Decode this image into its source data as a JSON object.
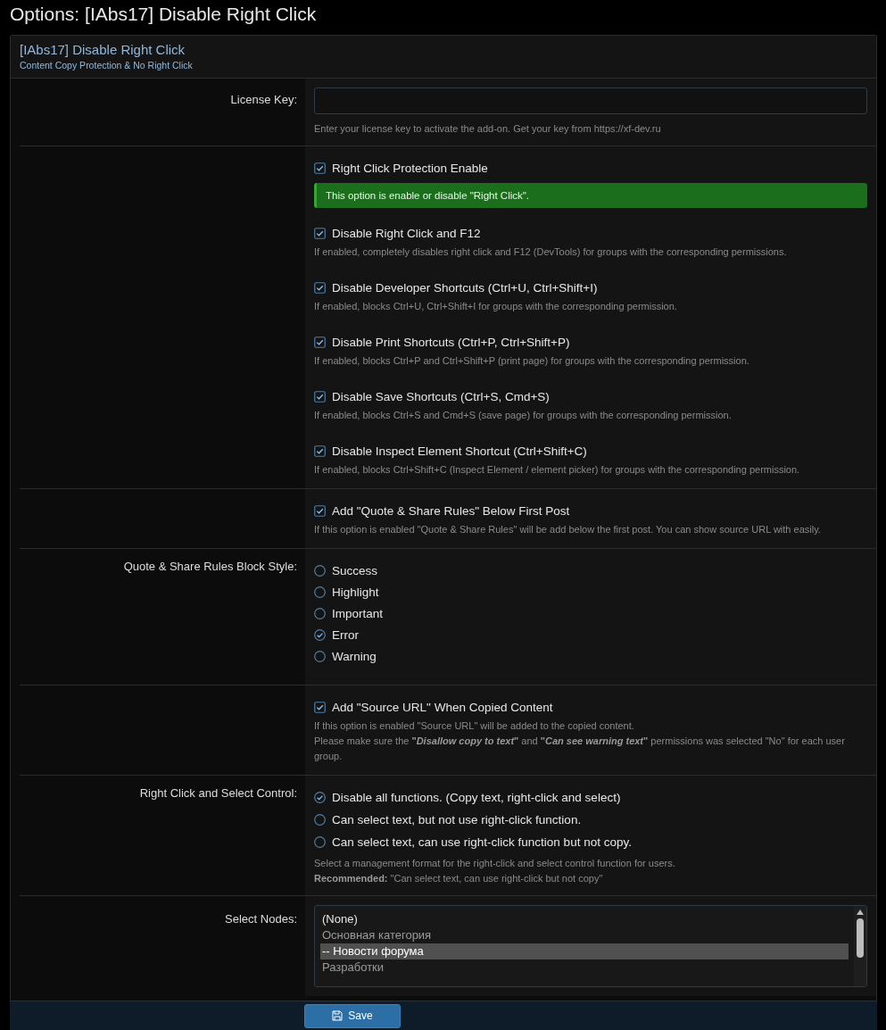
{
  "page_title": "Options: [IAbs17] Disable Right Click",
  "card": {
    "title": "[IAbs17] Disable Right Click",
    "subtitle": "Content Copy Protection & No Right Click"
  },
  "rows": [
    {
      "kind": "input",
      "label": "License Key:",
      "hint": [
        "Enter your license key to activate the add-on. Get your key from https://xf-dev.ru"
      ]
    },
    {
      "kind": "checks",
      "items": [
        {
          "label": "Right Click Protection Enable",
          "checked": true,
          "notice": "This option is enable or disable \"Right Click\"."
        },
        {
          "label": "Disable Right Click and F12",
          "checked": true,
          "hint": [
            "If enabled, completely disables right click and F12 (DevTools) for groups with the corresponding permissions."
          ]
        },
        {
          "label": "Disable Developer Shortcuts (Ctrl+U, Ctrl+Shift+I)",
          "checked": true,
          "hint": [
            "If enabled, blocks Ctrl+U, Ctrl+Shift+I for groups with the corresponding permission."
          ]
        },
        {
          "label": "Disable Print Shortcuts (Ctrl+P, Ctrl+Shift+P)",
          "checked": true,
          "hint": [
            "If enabled, blocks Ctrl+P and Ctrl+Shift+P (print page) for groups with the corresponding permission."
          ]
        },
        {
          "label": "Disable Save Shortcuts (Ctrl+S, Cmd+S)",
          "checked": true,
          "hint": [
            "If enabled, blocks Ctrl+S and Cmd+S (save page) for groups with the corresponding permission."
          ]
        },
        {
          "label": "Disable Inspect Element Shortcut (Ctrl+Shift+C)",
          "checked": true,
          "hint": [
            "If enabled, blocks Ctrl+Shift+C (Inspect Element / element picker) for groups with the corresponding permission."
          ]
        }
      ]
    },
    {
      "kind": "checks",
      "items": [
        {
          "label": "Add \"Quote & Share Rules\" Below First Post",
          "checked": true,
          "hint": [
            "If this option is enabled \"Quote & Share Rules\" will be add below the first post. You can show source URL with easily."
          ]
        }
      ]
    },
    {
      "kind": "radios",
      "label": "Quote & Share Rules Block Style:",
      "options": [
        {
          "label": "Success",
          "selected": false
        },
        {
          "label": "Highlight",
          "selected": false
        },
        {
          "label": "Important",
          "selected": false
        },
        {
          "label": "Error",
          "selected": true
        },
        {
          "label": "Warning",
          "selected": false
        }
      ]
    },
    {
      "kind": "checks",
      "items": [
        {
          "label": "Add \"Source URL\" When Copied Content",
          "checked": true,
          "hint": [
            "If this option is enabled \"Source URL\" will be added to the copied content.",
            "Please make sure the **\"*Disallow copy to text*\"** and **\"*Can see warning text*\"** permissions was selected \"No\" for each user group."
          ]
        }
      ]
    },
    {
      "kind": "radios",
      "label": "Right Click and Select Control:",
      "options": [
        {
          "label": "Disable all functions. (Copy text, right-click and select)",
          "selected": true
        },
        {
          "label": "Can select text, but not use right-click function.",
          "selected": false
        },
        {
          "label": "Can select text, can use right-click function but not copy.",
          "selected": false
        }
      ],
      "hint": [
        "Select a management format for the right-click and select control function for users.",
        "**Recommended:** \"Can select text, can use right-click but not copy\""
      ]
    },
    {
      "kind": "listbox",
      "label": "Select Nodes:",
      "options": [
        {
          "label": "(None)",
          "selected": false,
          "disabled": false
        },
        {
          "label": "Основная категория",
          "selected": false,
          "disabled": true
        },
        {
          "label": "-- Новости форума",
          "selected": true,
          "disabled": false
        },
        {
          "label": "Разработки",
          "selected": false,
          "disabled": true
        }
      ]
    }
  ],
  "save_button": "Save"
}
